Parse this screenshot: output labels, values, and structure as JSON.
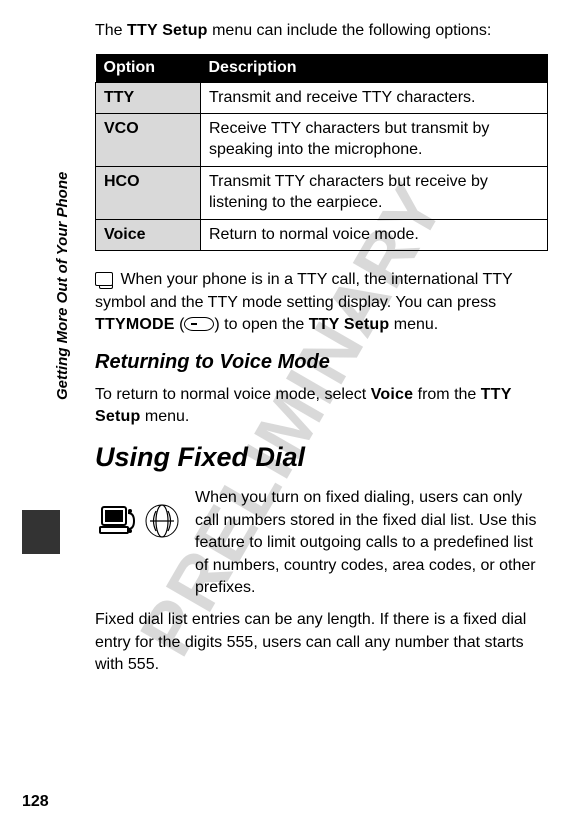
{
  "watermark": "PRELIMINARY",
  "sidebar_label": "Getting More Out of Your Phone",
  "page_number": "128",
  "intro_prefix": "The ",
  "intro_menu": "TTY Setup",
  "intro_suffix": " menu can include the following options:",
  "table": {
    "head_option": "Option",
    "head_desc": "Description",
    "rows": [
      {
        "opt": "TTY",
        "desc": "Transmit and receive TTY characters."
      },
      {
        "opt": "VCO",
        "desc": "Receive TTY characters but transmit by speaking into the microphone."
      },
      {
        "opt": "HCO",
        "desc": "Transmit TTY characters but receive by listening to the earpiece."
      },
      {
        "opt": "Voice",
        "desc": "Return to normal voice mode."
      }
    ]
  },
  "tty_para_1": "When your phone is in a TTY call, the international TTY symbol and the TTY mode setting display. You can press ",
  "tty_para_key": "TTYMODE",
  "tty_para_2": " (",
  "tty_para_3": ") to open the ",
  "tty_para_menu": "TTY Setup",
  "tty_para_4": " menu.",
  "return_heading": "Returning to Voice Mode",
  "return_para_1": "To return to normal voice mode, select ",
  "return_para_opt": "Voice",
  "return_para_2": " from the ",
  "return_para_menu": "TTY Setup",
  "return_para_3": " menu.",
  "fixed_heading": "Using Fixed Dial",
  "fixed_para1": "When you turn on fixed dialing, users can only call numbers stored in the fixed dial list. Use this feature to limit outgoing calls to a predefined list of numbers, country codes, area codes, or other prefixes.",
  "fixed_para2": "Fixed dial list entries can be any length. If there is a fixed dial entry for the digits 555, users can call any number that starts with 555."
}
